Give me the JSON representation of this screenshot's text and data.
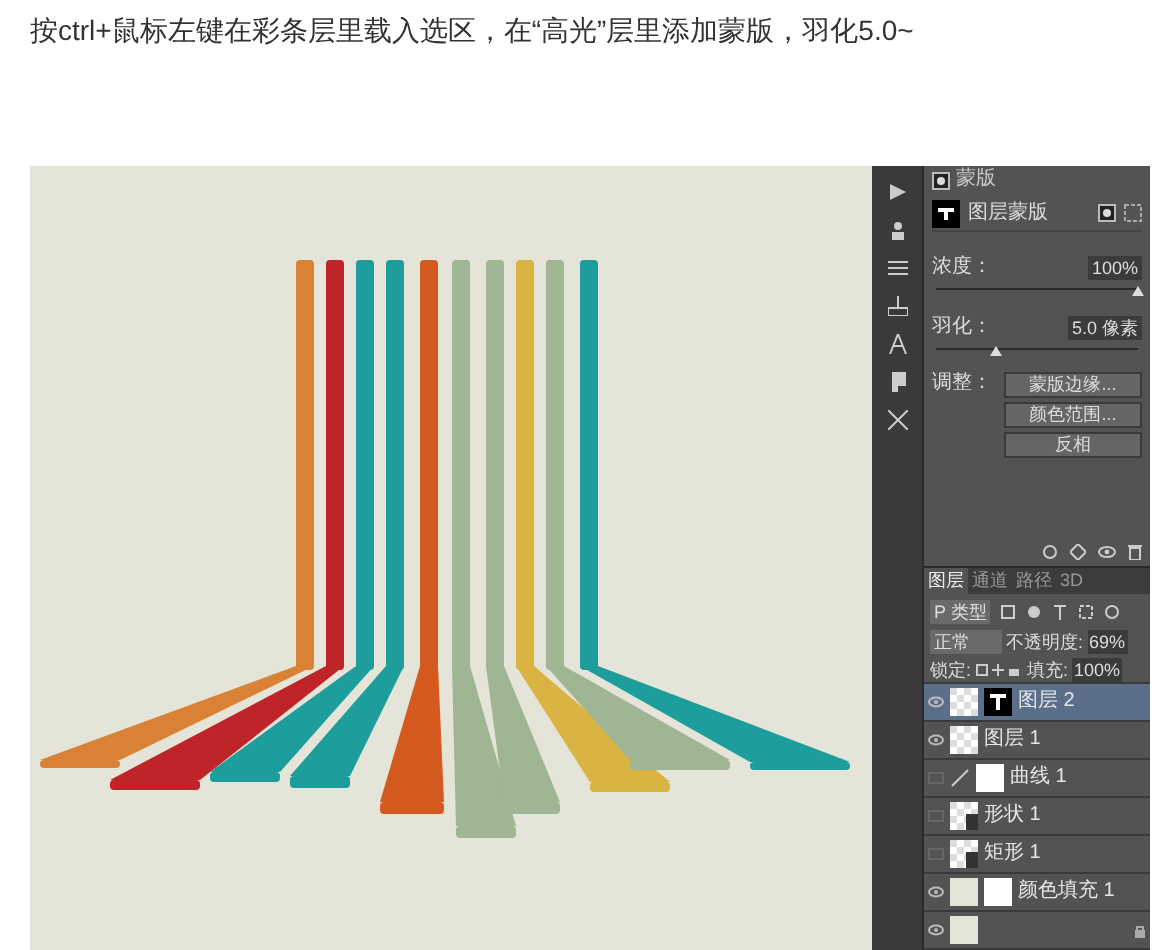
{
  "caption": "按ctrl+鼠标左键在彩条层里载入选区，在“高光”层里添加蒙版，羽化5.0~",
  "properties": {
    "header": "蒙版",
    "mask_type": "图层蒙版",
    "density": {
      "label": "浓度：",
      "value": "100%",
      "level": 1
    },
    "feather": {
      "label": "羽化：",
      "value": "5.0 像素",
      "level": 0.3
    },
    "adjust_label": "调整：",
    "buttons": [
      "蒙版边缘...",
      "颜色范围...",
      "反相"
    ]
  },
  "layers_panel": {
    "tabs": [
      {
        "label": "图层",
        "selected": true
      },
      {
        "label": "通道",
        "selected": false
      },
      {
        "label": "路径",
        "selected": false
      },
      {
        "label": "3D",
        "selected": false
      }
    ],
    "filter": "P 类型",
    "blend_mode": "正常",
    "opacity_label": "不透明度:",
    "opacity": "69%",
    "lock_label": "锁定:",
    "fill_label": "填充:",
    "fill": "100%",
    "layers": [
      {
        "name": "图层 2",
        "kind": "masked",
        "visible": true,
        "selected": true
      },
      {
        "name": "图层 1",
        "kind": "pixel",
        "visible": true,
        "selected": false
      },
      {
        "name": "曲线 1",
        "kind": "adjustment",
        "visible": false,
        "selected": false
      },
      {
        "name": "形状 1",
        "kind": "shape",
        "visible": false,
        "selected": false
      },
      {
        "name": "矩形 1",
        "kind": "shape",
        "visible": false,
        "selected": false
      },
      {
        "name": "颜色填充 1",
        "kind": "fill",
        "visible": true,
        "selected": false
      },
      {
        "kind": "background",
        "visible": true,
        "selected": false,
        "locked": true
      }
    ]
  }
}
